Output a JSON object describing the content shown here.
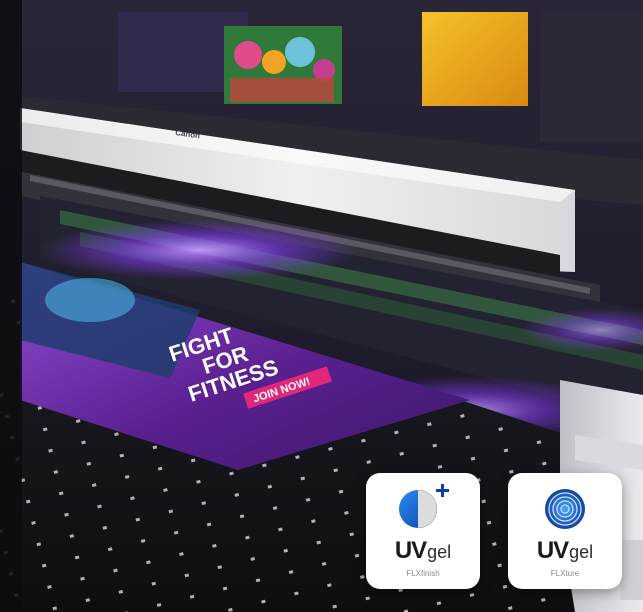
{
  "printer": {
    "brand_label": "Canon"
  },
  "banner": {
    "line1": "FIGHT",
    "line2": "FOR",
    "line3": "FITNESS",
    "cta": "JOIN NOW!"
  },
  "badges": [
    {
      "brand_main": "UV",
      "brand_suffix": "gel",
      "sub": "FLXfinish",
      "icon": "half-moon-plus-icon"
    },
    {
      "brand_main": "UV",
      "brand_suffix": "gel",
      "sub": "FLXture",
      "icon": "concentric-rings-icon"
    }
  ],
  "colors": {
    "uv_glow": "#8a3cff",
    "banner_purple": "#5a1f8f",
    "cta_pink": "#e0277a",
    "icon_blue": "#1b67d8",
    "printer_body": "#e6e6e6"
  }
}
